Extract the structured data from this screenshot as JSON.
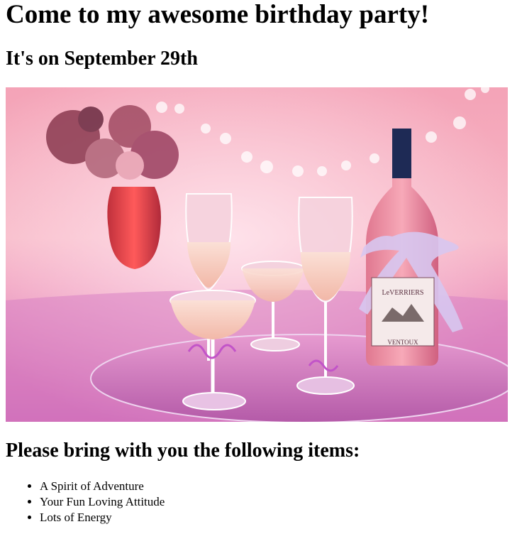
{
  "heading": "Come to my awesome birthday party!",
  "subheading": "It's on September 29th",
  "image": {
    "description_alt": "Pink champagne glasses and bottle",
    "bottle_label_brand": "LeVERRIERS",
    "bottle_label_region": "VENTOUX"
  },
  "bring_heading": "Please bring with you the following items:",
  "items": [
    "A Spirit of Adventure",
    "Your Fun Loving Attitude",
    "Lots of Energy"
  ]
}
